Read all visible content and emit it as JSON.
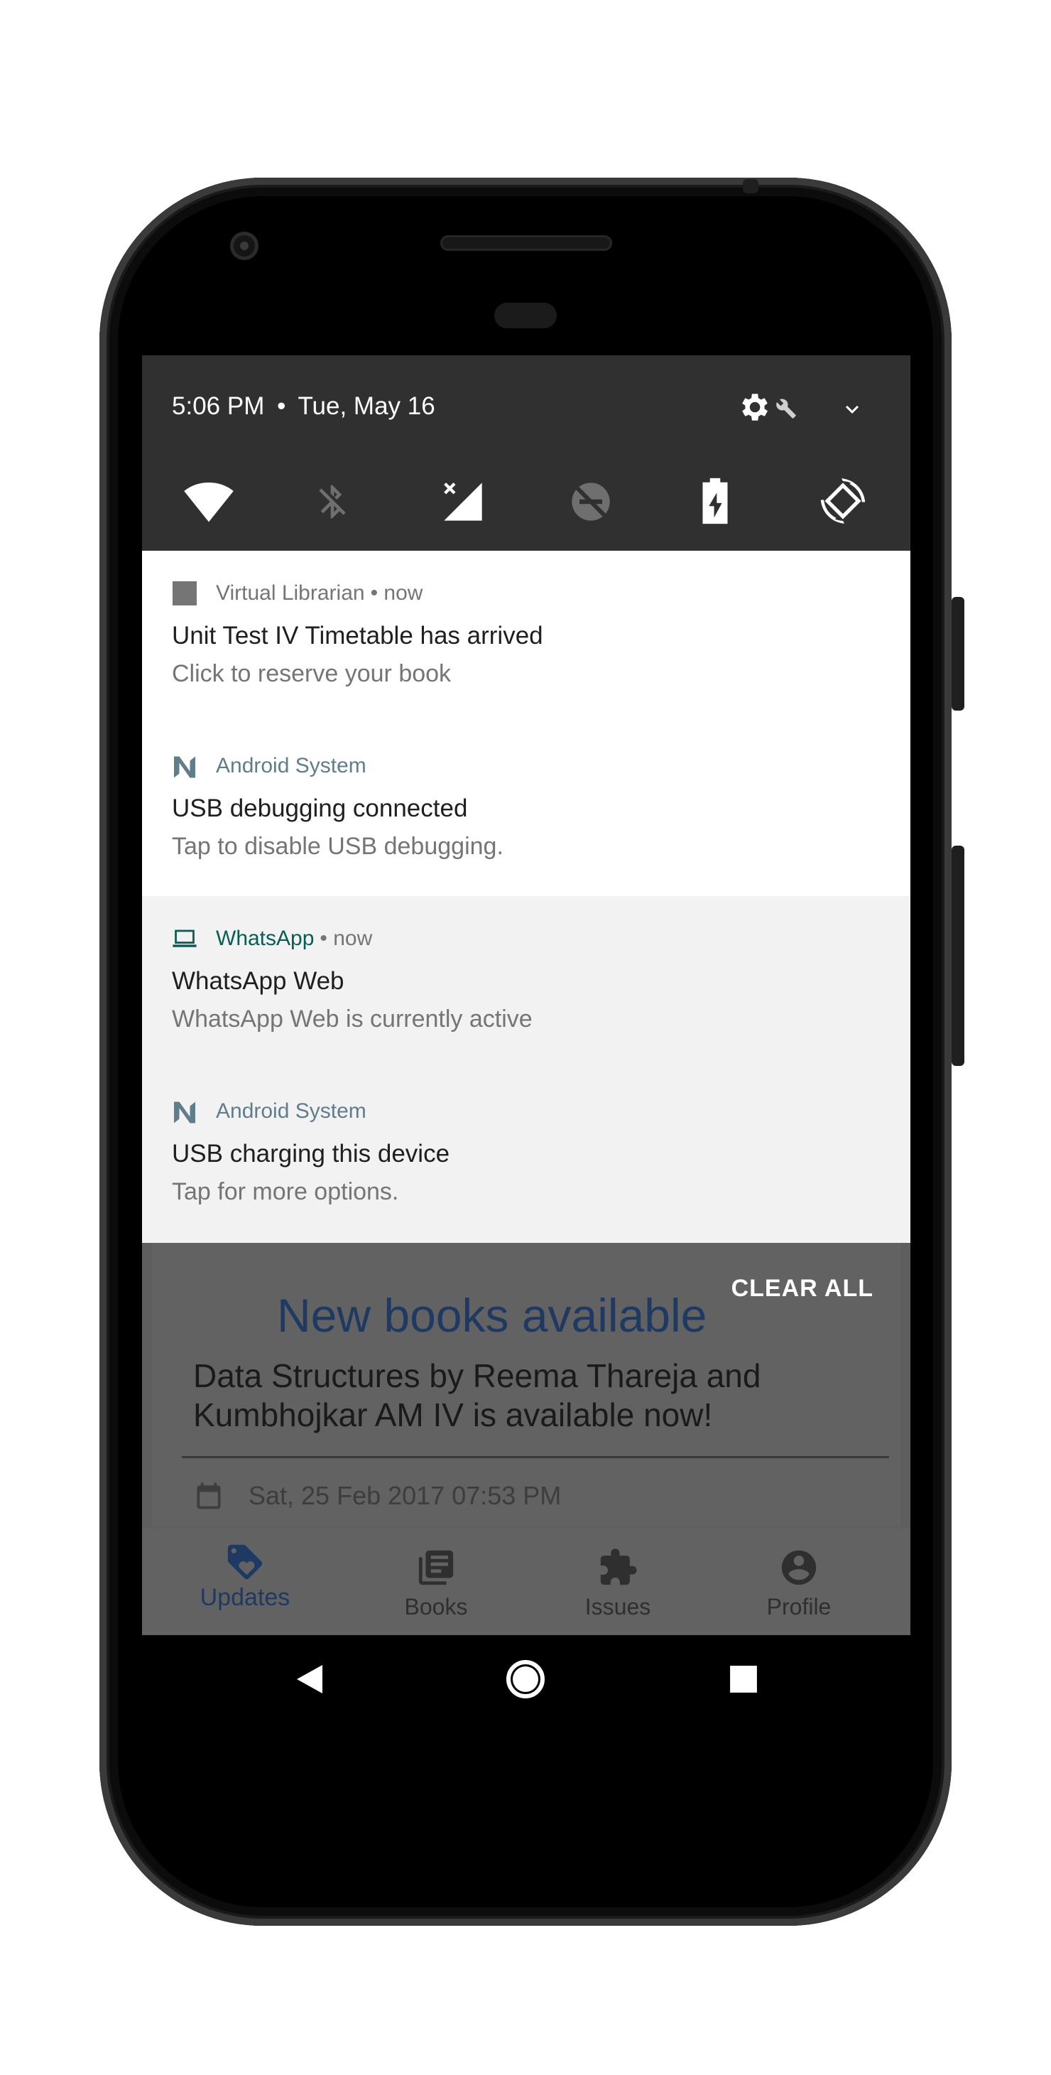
{
  "status": {
    "time": "5:06 PM",
    "separator": "•",
    "date": "Tue, May 16"
  },
  "quick_settings": [
    "wifi-icon",
    "bluetooth-off-icon",
    "mobile-signal-off-icon",
    "do-not-disturb-off-icon",
    "battery-charging-icon",
    "auto-rotate-icon"
  ],
  "notifications": [
    {
      "app": "Virtual Librarian",
      "time": "• now",
      "title": "Unit Test IV Timetable has arrived",
      "text": "Click to reserve your book",
      "app_color": "#757575",
      "icon": "square-app-icon"
    },
    {
      "app": "Android System",
      "time": "",
      "title": "USB debugging connected",
      "text": "Tap to disable USB debugging.",
      "app_color": "#607d8b",
      "icon": "android-n-icon"
    },
    {
      "app": "WhatsApp",
      "time": "• now",
      "title": "WhatsApp Web",
      "text": "WhatsApp Web is currently active",
      "app_color": "#075e54",
      "icon": "laptop-icon"
    },
    {
      "app": "Android System",
      "time": "",
      "title": "USB charging this device",
      "text": "Tap for more options.",
      "app_color": "#607d8b",
      "icon": "android-n-icon"
    }
  ],
  "clear_all": "CLEAR ALL",
  "app": {
    "card_title": "New books available",
    "card_message": "Data Structures by Reema Thareja and Kumbhojkar AM IV is available now!",
    "card_date": "Sat, 25 Feb 2017 07:53 PM",
    "nav": [
      {
        "label": "Updates",
        "icon": "tag-heart-icon",
        "active": true
      },
      {
        "label": "Books",
        "icon": "library-books-icon",
        "active": false
      },
      {
        "label": "Issues",
        "icon": "puzzle-icon",
        "active": false
      },
      {
        "label": "Profile",
        "icon": "account-circle-icon",
        "active": false
      }
    ]
  },
  "colors": {
    "quick_settings_bg": "#303030",
    "notif_light": "#ffffff",
    "notif_dim": "#f2f2f2",
    "app_title": "#1e3a63",
    "nav_active": "#1e3a63"
  }
}
